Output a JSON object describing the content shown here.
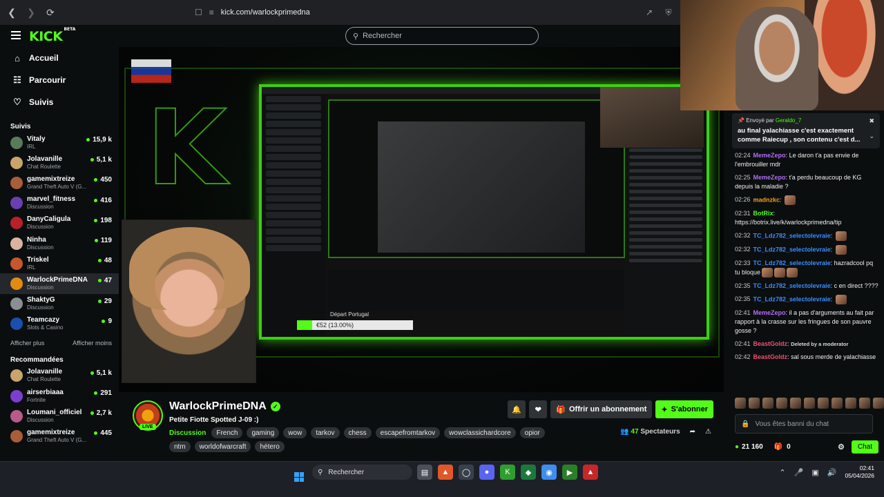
{
  "browser": {
    "url": "kick.com/warlockprimedna"
  },
  "header": {
    "logo": "KICK",
    "logo_badge": "BETA",
    "search_placeholder": "Rechercher"
  },
  "sidebar": {
    "nav": [
      {
        "label": "Accueil",
        "icon": "home-icon"
      },
      {
        "label": "Parcourir",
        "icon": "browse-icon"
      },
      {
        "label": "Suivis",
        "icon": "heart-icon"
      }
    ],
    "followed_title": "Suivis",
    "followed": [
      {
        "name": "Vitaly",
        "category": "IRL",
        "viewers": "15,9 k",
        "color": "#5b7a5c"
      },
      {
        "name": "Jolavanille",
        "category": "Chat Roulette",
        "viewers": "5,1 k",
        "color": "#c9a46b"
      },
      {
        "name": "gamemixtreize",
        "category": "Grand Theft Auto V (G...",
        "viewers": "450",
        "color": "#a85d3b"
      },
      {
        "name": "marvel_fitness",
        "category": "Discussion",
        "viewers": "416",
        "color": "#6a3fb0"
      },
      {
        "name": "DanyCaligula",
        "category": "Discussion",
        "viewers": "198",
        "color": "#b8202a"
      },
      {
        "name": "Ninha",
        "category": "Discussion",
        "viewers": "119",
        "color": "#d8b4a0"
      },
      {
        "name": "Triskel",
        "category": "IRL",
        "viewers": "48",
        "color": "#c7562b"
      },
      {
        "name": "WarlockPrimeDNA",
        "category": "Discussion",
        "viewers": "47",
        "color": "#e38a12",
        "active": true
      },
      {
        "name": "ShaktyG",
        "category": "Discussion",
        "viewers": "29",
        "color": "#8a8f94"
      },
      {
        "name": "Teamcazy",
        "category": "Slots & Casino",
        "viewers": "9",
        "color": "#1a4fb0"
      }
    ],
    "show_more": "Afficher plus",
    "show_less": "Afficher moins",
    "recommended_title": "Recommandées",
    "recommended": [
      {
        "name": "Jolavanille",
        "category": "Chat Roulette",
        "viewers": "5,1 k",
        "color": "#c9a46b"
      },
      {
        "name": "airserbiaaa",
        "category": "Fortnite",
        "viewers": "291",
        "color": "#7b3fd0"
      },
      {
        "name": "Loumani_officiel",
        "category": "Discussion",
        "viewers": "2,7 k",
        "color": "#b85a8a"
      },
      {
        "name": "gamemixtreize",
        "category": "Grand Theft Auto V (G...",
        "viewers": "445",
        "color": "#a85d3b"
      }
    ]
  },
  "stream_overlay": {
    "goal_label": "€52 (13.00%)",
    "goal_progress": 0.13,
    "departure_label": "Départ Portugal"
  },
  "channel": {
    "name": "WarlockPrimeDNA",
    "live_label": "LIVE",
    "title": "Petite Fiotte Spotted J-09 :)",
    "category": "Discussion",
    "tags": [
      "French",
      "gaming",
      "wow",
      "tarkov",
      "chess",
      "escapefromtarkov",
      "wowclassichardcore",
      "opior",
      "ntm",
      "worldofwarcraft",
      "hétero"
    ],
    "subscribe_gift_label": "Offrir un abonnement",
    "subscribe_label": "S'abonner",
    "viewers": "47",
    "viewers_label": "Spectateurs"
  },
  "chat": {
    "pinned_by_label": "Envoyé par",
    "pinned_by_user": "Geraldo_7",
    "pinned_text": "au final yalachiasse c'est exactement comme Raiecup , son contenu c'est d...",
    "messages": [
      {
        "time": "02:24",
        "user": "MemeZepo",
        "color": "#b36cf5",
        "text": "Le daron t'a pas envie de l'embrouiller mdr"
      },
      {
        "time": "02:25",
        "user": "MemeZepo",
        "color": "#b36cf5",
        "text": "t'a perdu beaucoup de KG depuis la maladie ?"
      },
      {
        "time": "02:26",
        "user": "madnzkc",
        "color": "#f0a020",
        "text": "",
        "emotes": 1
      },
      {
        "time": "02:31",
        "user": "BotRix",
        "color": "#53fc18",
        "text": "https://botrix.live/k/warlockprimedna/tip"
      },
      {
        "time": "02:32",
        "user": "TC_Ldz782_selectolevraie",
        "color": "#3a8dff",
        "text": "",
        "emotes": 1
      },
      {
        "time": "02:32",
        "user": "TC_Ldz782_selectolevraie",
        "color": "#3a8dff",
        "text": "",
        "emotes": 1
      },
      {
        "time": "02:33",
        "user": "TC_Ldz782_selectolevraie",
        "color": "#3a8dff",
        "text": "hazradcool pq tu bloque",
        "emotes": 3
      },
      {
        "time": "02:35",
        "user": "TC_Ldz782_selectolevraie",
        "color": "#3a8dff",
        "text": "c en direct ????"
      },
      {
        "time": "02:35",
        "user": "TC_Ldz782_selectolevraie",
        "color": "#3a8dff",
        "text": "",
        "emotes": 1
      },
      {
        "time": "02:41",
        "user": "MemeZepo",
        "color": "#b36cf5",
        "text": "il a pas d'arguments au fait par rapport à la crasse sur les fringues de son pauvre gosse ?"
      },
      {
        "time": "02:41",
        "user": "BeastGoldz",
        "color": "#f0506e",
        "text": "",
        "note": "Deleted by a moderator"
      },
      {
        "time": "02:42",
        "user": "BeastGoldz",
        "color": "#f0506e",
        "text": "sal sous merde de yalachiasse"
      }
    ],
    "input_placeholder": "Vous êtes banni du chat",
    "points": "21 160",
    "gifts": "0",
    "chat_button": "Chat"
  },
  "taskbar": {
    "search_placeholder": "Rechercher",
    "time": "02:41",
    "date": "05/04/2026"
  }
}
